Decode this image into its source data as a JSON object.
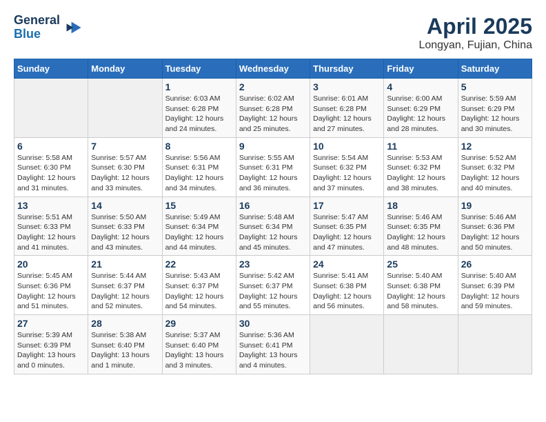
{
  "header": {
    "logo_line1": "General",
    "logo_line2": "Blue",
    "month_year": "April 2025",
    "location": "Longyan, Fujian, China"
  },
  "weekdays": [
    "Sunday",
    "Monday",
    "Tuesday",
    "Wednesday",
    "Thursday",
    "Friday",
    "Saturday"
  ],
  "weeks": [
    [
      {
        "day": "",
        "empty": true
      },
      {
        "day": "",
        "empty": true
      },
      {
        "day": "1",
        "sunrise": "Sunrise: 6:03 AM",
        "sunset": "Sunset: 6:28 PM",
        "daylight": "Daylight: 12 hours and 24 minutes."
      },
      {
        "day": "2",
        "sunrise": "Sunrise: 6:02 AM",
        "sunset": "Sunset: 6:28 PM",
        "daylight": "Daylight: 12 hours and 25 minutes."
      },
      {
        "day": "3",
        "sunrise": "Sunrise: 6:01 AM",
        "sunset": "Sunset: 6:28 PM",
        "daylight": "Daylight: 12 hours and 27 minutes."
      },
      {
        "day": "4",
        "sunrise": "Sunrise: 6:00 AM",
        "sunset": "Sunset: 6:29 PM",
        "daylight": "Daylight: 12 hours and 28 minutes."
      },
      {
        "day": "5",
        "sunrise": "Sunrise: 5:59 AM",
        "sunset": "Sunset: 6:29 PM",
        "daylight": "Daylight: 12 hours and 30 minutes."
      }
    ],
    [
      {
        "day": "6",
        "sunrise": "Sunrise: 5:58 AM",
        "sunset": "Sunset: 6:30 PM",
        "daylight": "Daylight: 12 hours and 31 minutes."
      },
      {
        "day": "7",
        "sunrise": "Sunrise: 5:57 AM",
        "sunset": "Sunset: 6:30 PM",
        "daylight": "Daylight: 12 hours and 33 minutes."
      },
      {
        "day": "8",
        "sunrise": "Sunrise: 5:56 AM",
        "sunset": "Sunset: 6:31 PM",
        "daylight": "Daylight: 12 hours and 34 minutes."
      },
      {
        "day": "9",
        "sunrise": "Sunrise: 5:55 AM",
        "sunset": "Sunset: 6:31 PM",
        "daylight": "Daylight: 12 hours and 36 minutes."
      },
      {
        "day": "10",
        "sunrise": "Sunrise: 5:54 AM",
        "sunset": "Sunset: 6:32 PM",
        "daylight": "Daylight: 12 hours and 37 minutes."
      },
      {
        "day": "11",
        "sunrise": "Sunrise: 5:53 AM",
        "sunset": "Sunset: 6:32 PM",
        "daylight": "Daylight: 12 hours and 38 minutes."
      },
      {
        "day": "12",
        "sunrise": "Sunrise: 5:52 AM",
        "sunset": "Sunset: 6:32 PM",
        "daylight": "Daylight: 12 hours and 40 minutes."
      }
    ],
    [
      {
        "day": "13",
        "sunrise": "Sunrise: 5:51 AM",
        "sunset": "Sunset: 6:33 PM",
        "daylight": "Daylight: 12 hours and 41 minutes."
      },
      {
        "day": "14",
        "sunrise": "Sunrise: 5:50 AM",
        "sunset": "Sunset: 6:33 PM",
        "daylight": "Daylight: 12 hours and 43 minutes."
      },
      {
        "day": "15",
        "sunrise": "Sunrise: 5:49 AM",
        "sunset": "Sunset: 6:34 PM",
        "daylight": "Daylight: 12 hours and 44 minutes."
      },
      {
        "day": "16",
        "sunrise": "Sunrise: 5:48 AM",
        "sunset": "Sunset: 6:34 PM",
        "daylight": "Daylight: 12 hours and 45 minutes."
      },
      {
        "day": "17",
        "sunrise": "Sunrise: 5:47 AM",
        "sunset": "Sunset: 6:35 PM",
        "daylight": "Daylight: 12 hours and 47 minutes."
      },
      {
        "day": "18",
        "sunrise": "Sunrise: 5:46 AM",
        "sunset": "Sunset: 6:35 PM",
        "daylight": "Daylight: 12 hours and 48 minutes."
      },
      {
        "day": "19",
        "sunrise": "Sunrise: 5:46 AM",
        "sunset": "Sunset: 6:36 PM",
        "daylight": "Daylight: 12 hours and 50 minutes."
      }
    ],
    [
      {
        "day": "20",
        "sunrise": "Sunrise: 5:45 AM",
        "sunset": "Sunset: 6:36 PM",
        "daylight": "Daylight: 12 hours and 51 minutes."
      },
      {
        "day": "21",
        "sunrise": "Sunrise: 5:44 AM",
        "sunset": "Sunset: 6:37 PM",
        "daylight": "Daylight: 12 hours and 52 minutes."
      },
      {
        "day": "22",
        "sunrise": "Sunrise: 5:43 AM",
        "sunset": "Sunset: 6:37 PM",
        "daylight": "Daylight: 12 hours and 54 minutes."
      },
      {
        "day": "23",
        "sunrise": "Sunrise: 5:42 AM",
        "sunset": "Sunset: 6:37 PM",
        "daylight": "Daylight: 12 hours and 55 minutes."
      },
      {
        "day": "24",
        "sunrise": "Sunrise: 5:41 AM",
        "sunset": "Sunset: 6:38 PM",
        "daylight": "Daylight: 12 hours and 56 minutes."
      },
      {
        "day": "25",
        "sunrise": "Sunrise: 5:40 AM",
        "sunset": "Sunset: 6:38 PM",
        "daylight": "Daylight: 12 hours and 58 minutes."
      },
      {
        "day": "26",
        "sunrise": "Sunrise: 5:40 AM",
        "sunset": "Sunset: 6:39 PM",
        "daylight": "Daylight: 12 hours and 59 minutes."
      }
    ],
    [
      {
        "day": "27",
        "sunrise": "Sunrise: 5:39 AM",
        "sunset": "Sunset: 6:39 PM",
        "daylight": "Daylight: 13 hours and 0 minutes."
      },
      {
        "day": "28",
        "sunrise": "Sunrise: 5:38 AM",
        "sunset": "Sunset: 6:40 PM",
        "daylight": "Daylight: 13 hours and 1 minute."
      },
      {
        "day": "29",
        "sunrise": "Sunrise: 5:37 AM",
        "sunset": "Sunset: 6:40 PM",
        "daylight": "Daylight: 13 hours and 3 minutes."
      },
      {
        "day": "30",
        "sunrise": "Sunrise: 5:36 AM",
        "sunset": "Sunset: 6:41 PM",
        "daylight": "Daylight: 13 hours and 4 minutes."
      },
      {
        "day": "",
        "empty": true
      },
      {
        "day": "",
        "empty": true
      },
      {
        "day": "",
        "empty": true
      }
    ]
  ]
}
